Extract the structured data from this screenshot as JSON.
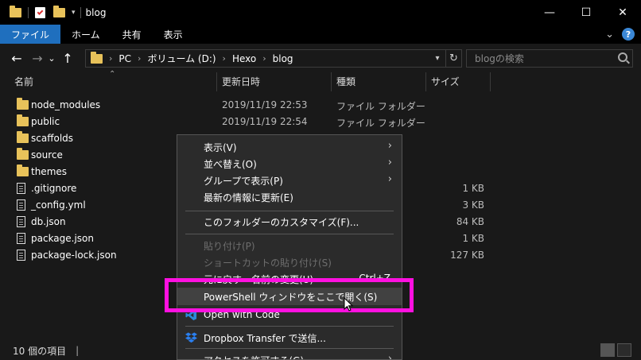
{
  "window": {
    "title": "blog",
    "minimize": "—",
    "maximize": "☐",
    "close": "✕"
  },
  "ribbon": {
    "tabs": [
      {
        "label": "ファイル",
        "active": true
      },
      {
        "label": "ホーム"
      },
      {
        "label": "共有"
      },
      {
        "label": "表示"
      }
    ],
    "collapse_icon": "⌄",
    "help": "?"
  },
  "nav": {
    "back": "←",
    "forward": "→",
    "recent": "⌄",
    "up": "↑"
  },
  "address": {
    "crumbs": [
      "PC",
      "ボリューム (D:)",
      "Hexo",
      "blog"
    ],
    "separator": "›"
  },
  "search": {
    "placeholder": "blogの検索"
  },
  "columns": {
    "name": "名前",
    "modified": "更新日時",
    "type": "種類",
    "size": "サイズ"
  },
  "files": [
    {
      "name": "node_modules",
      "date": "2019/11/19 22:53",
      "type": "ファイル フォルダー",
      "size": "",
      "kind": "folder"
    },
    {
      "name": "public",
      "date": "2019/11/19 22:54",
      "type": "ファイル フォルダー",
      "size": "",
      "kind": "folder"
    },
    {
      "name": "scaffolds",
      "date": "",
      "type": "",
      "size": "",
      "kind": "folder"
    },
    {
      "name": "source",
      "date": "",
      "type": "",
      "size": "",
      "kind": "folder"
    },
    {
      "name": "themes",
      "date": "",
      "type": "",
      "size": "",
      "kind": "folder"
    },
    {
      "name": ".gitignore",
      "date": "",
      "type": "",
      "size": "1 KB",
      "kind": "file"
    },
    {
      "name": "_config.yml",
      "date": "",
      "type": "",
      "size": "3 KB",
      "kind": "file"
    },
    {
      "name": "db.json",
      "date": "",
      "type": "",
      "size": "84 KB",
      "kind": "file"
    },
    {
      "name": "package.json",
      "date": "",
      "type": "",
      "size": "1 KB",
      "kind": "file"
    },
    {
      "name": "package-lock.json",
      "date": "",
      "type": "",
      "size": "127 KB",
      "kind": "file"
    }
  ],
  "status": {
    "count": "10 個の項目"
  },
  "context_menu": {
    "items": [
      {
        "label": "表示(V)",
        "submenu": true
      },
      {
        "label": "並べ替え(O)",
        "submenu": true
      },
      {
        "label": "グループで表示(P)",
        "submenu": true
      },
      {
        "label": "最新の情報に更新(E)"
      },
      {
        "label": "このフォルダーのカスタマイズ(F)..."
      },
      {
        "label": "貼り付け(P)",
        "disabled": true
      },
      {
        "label": "ショートカットの貼り付け(S)",
        "disabled": true
      },
      {
        "label": "元に戻す - 名前の変更(U)"
      },
      {
        "label": "PowerShell ウィンドウをここで開く(S)",
        "hover": true
      },
      {
        "label": "Open with Code"
      },
      {
        "label": "Dropbox Transfer で送信..."
      },
      {
        "label": "アクセスを許可する(G)",
        "submenu": true
      }
    ],
    "undo_shortcut": "Ctrl+Z",
    "submenu_arrow": "›"
  },
  "colors": {
    "accent": "#1f6fbe",
    "folder": "#e8c25a",
    "highlight": "#ff10e0",
    "menu_bg": "#2b2b2b",
    "window_bg": "#191919"
  }
}
